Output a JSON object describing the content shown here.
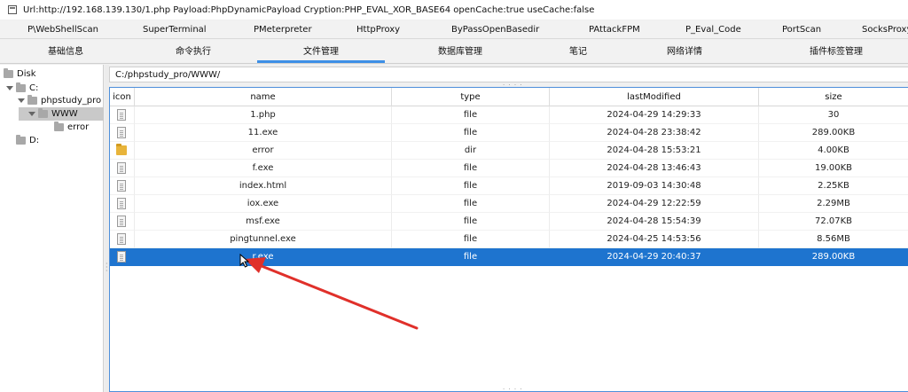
{
  "window": {
    "title": "Url:http://192.168.139.130/1.php Payload:PhpDynamicPayload Cryption:PHP_EVAL_XOR_BASE64 openCache:true useCache:false"
  },
  "plugin_tabs": [
    {
      "label": "P\\WebShellScan"
    },
    {
      "label": "SuperTerminal"
    },
    {
      "label": "PMeterpreter"
    },
    {
      "label": "HttpProxy"
    },
    {
      "label": "ByPassOpenBasedir"
    },
    {
      "label": "PAttackFPM"
    },
    {
      "label": "P_Eval_Code"
    },
    {
      "label": "PortScan"
    },
    {
      "label": "SocksProxy"
    }
  ],
  "func_tabs": [
    {
      "label": "基础信息"
    },
    {
      "label": "命令执行"
    },
    {
      "label": "文件管理"
    },
    {
      "label": "数据库管理"
    },
    {
      "label": "笔记"
    },
    {
      "label": "网络详情"
    },
    {
      "label": "插件标签管理"
    }
  ],
  "tree": {
    "items": [
      {
        "label": "Disk"
      },
      {
        "label": "C:"
      },
      {
        "label": "phpstudy_pro"
      },
      {
        "label": "WWW"
      },
      {
        "label": "error"
      },
      {
        "label": "D:"
      }
    ]
  },
  "pathbar": {
    "value": "C:/phpstudy_pro/WWW/"
  },
  "table": {
    "columns": [
      "icon",
      "name",
      "type",
      "lastModified",
      "size"
    ],
    "rows": [
      {
        "name": "1.php",
        "type": "file",
        "lastModified": "2024-04-29 14:29:33",
        "size": "30",
        "icon": "file-icon"
      },
      {
        "name": "11.exe",
        "type": "file",
        "lastModified": "2024-04-28 23:38:42",
        "size": "289.00KB",
        "icon": "file-icon"
      },
      {
        "name": "error",
        "type": "dir",
        "lastModified": "2024-04-28 15:53:21",
        "size": "4.00KB",
        "icon": "folder-icon"
      },
      {
        "name": "f.exe",
        "type": "file",
        "lastModified": "2024-04-28 13:46:43",
        "size": "19.00KB",
        "icon": "file-icon"
      },
      {
        "name": "index.html",
        "type": "file",
        "lastModified": "2019-09-03 14:30:48",
        "size": "2.25KB",
        "icon": "file-icon"
      },
      {
        "name": "iox.exe",
        "type": "file",
        "lastModified": "2024-04-29 12:22:59",
        "size": "2.29MB",
        "icon": "file-icon"
      },
      {
        "name": "msf.exe",
        "type": "file",
        "lastModified": "2024-04-28 15:54:39",
        "size": "72.07KB",
        "icon": "file-icon"
      },
      {
        "name": "pingtunnel.exe",
        "type": "file",
        "lastModified": "2024-04-25 14:53:56",
        "size": "8.56MB",
        "icon": "file-icon"
      },
      {
        "name": "r.exe",
        "type": "file",
        "lastModified": "2024-04-29 20:40:37",
        "size": "289.00KB",
        "icon": "file-icon",
        "selected": true
      }
    ]
  },
  "colors": {
    "selection": "#1e74cf",
    "accent_underline": "#3d8fe6",
    "annotation_arrow": "#e0302a"
  }
}
